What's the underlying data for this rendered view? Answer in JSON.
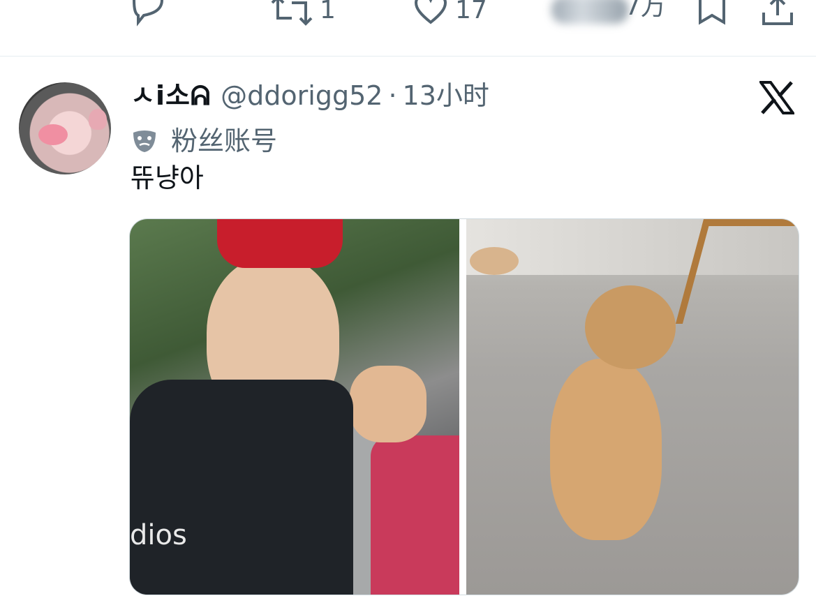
{
  "action_bar": {
    "reply_icon": "reply-icon",
    "retweet_icon": "retweet-icon",
    "retweet_count": "1",
    "like_icon": "heart-icon",
    "like_count": "17",
    "views_count": "7万",
    "bookmark_icon": "bookmark-icon",
    "share_icon": "share-icon"
  },
  "tweet": {
    "display_name": "ㅅi소ᕱ",
    "handle": "@ddorigg52",
    "separator": "·",
    "time": "13小时",
    "badge_label": "粉丝账号",
    "text": "뜌냥아",
    "media": {
      "left_shirt_text": "dios",
      "photos": [
        "photo-left",
        "photo-right"
      ]
    }
  },
  "colors": {
    "text_primary": "#0f1419",
    "text_secondary": "#536471",
    "divider": "#e6ecf0"
  }
}
